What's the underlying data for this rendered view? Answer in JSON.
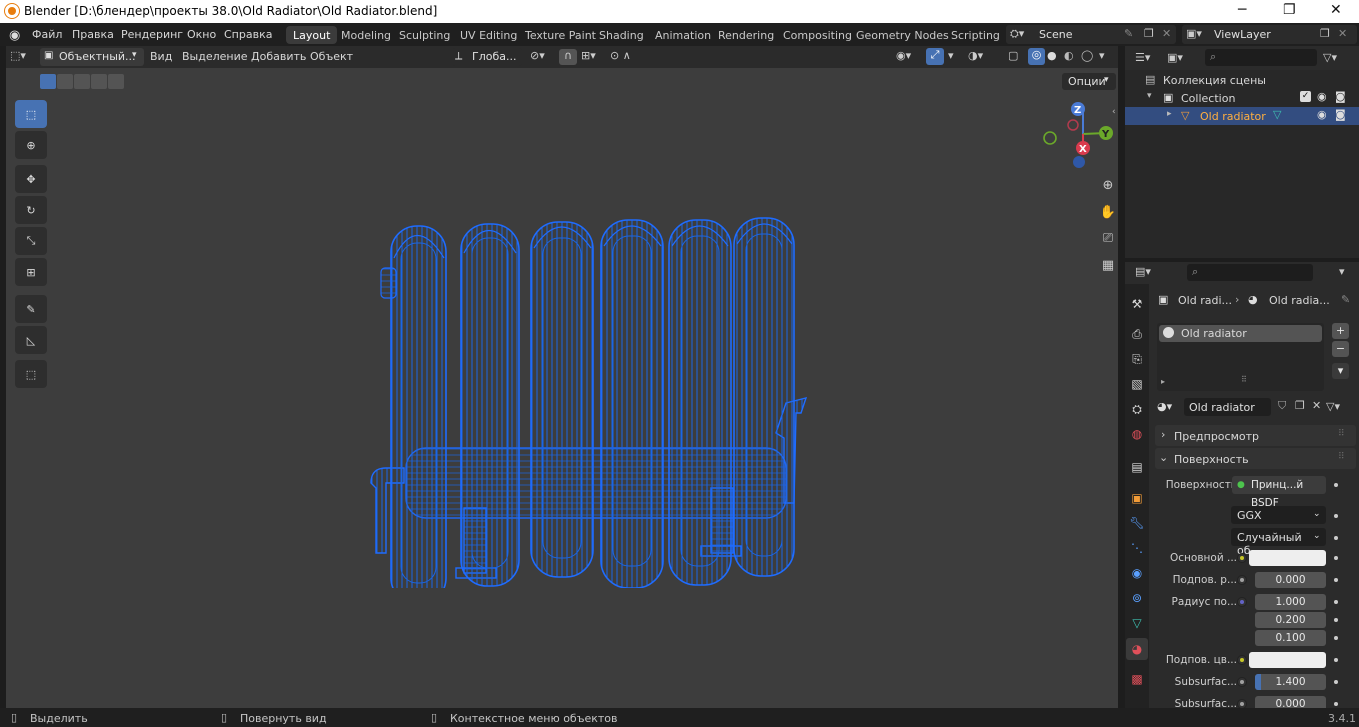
{
  "window": {
    "title": "Blender [D:\\блендер\\проекты 38.0\\Old Radiator\\Old Radiator.blend]",
    "minimize": "─",
    "maximize": "❐",
    "close": "✕"
  },
  "menu": [
    "Файл",
    "Правка",
    "Рендеринг",
    "Окно",
    "Справка"
  ],
  "workspaces": [
    "Layout",
    "Modeling",
    "Sculpting",
    "UV Editing",
    "Texture Paint",
    "Shading",
    "Animation",
    "Rendering",
    "Compositing",
    "Geometry Nodes",
    "Scripting"
  ],
  "active_workspace": "Layout",
  "scene": {
    "name": "Scene"
  },
  "view_layer": {
    "name": "ViewLayer"
  },
  "viewport_header": {
    "mode": "Объектный...",
    "menus": [
      "Вид",
      "Выделение",
      "Добавить",
      "Объект"
    ],
    "orientation": "Глоба...",
    "options": "Опции"
  },
  "gizmo": {
    "z": "Z",
    "y": "Y",
    "x": "X"
  },
  "outliner": {
    "scene_collection": "Коллекция сцены",
    "collection": "Collection",
    "object": "Old radiator"
  },
  "properties": {
    "breadcrumb": [
      "Old radi...",
      "Old radia..."
    ],
    "slot": "Old radiator",
    "material_name": "Old radiator",
    "panels": {
      "preview": "Предпросмотр",
      "surface": "Поверхность"
    },
    "surface_label": "Поверхность",
    "surface_shader": "Принц...й BSDF",
    "distribution": "GGX",
    "subsurface_method": "Случайный об...",
    "rows": [
      {
        "label": "Основной ...",
        "value": "",
        "type": "color",
        "color": "#eeeeee",
        "socket": "#c7c729"
      },
      {
        "label": "Подпов. р...",
        "value": "0.000",
        "type": "num",
        "socket": "#a1a1a1"
      },
      {
        "label": "Радиус по...",
        "value": "1.000",
        "type": "num",
        "socket": "#6363c7"
      },
      {
        "label": "",
        "value": "0.200",
        "type": "num",
        "socket": ""
      },
      {
        "label": "",
        "value": "0.100",
        "type": "num",
        "socket": ""
      },
      {
        "label": "Подпов. цв...",
        "value": "",
        "type": "color",
        "color": "#eeeeee",
        "socket": "#c7c729"
      },
      {
        "label": "Subsurfac...",
        "value": "1.400",
        "type": "num",
        "socket": "#a1a1a1"
      },
      {
        "label": "Subsurfac...",
        "value": "0.000",
        "type": "num",
        "socket": "#a1a1a1"
      }
    ]
  },
  "status": {
    "select": "Выделить",
    "rotate": "Повернуть вид",
    "context": "Контекстное меню объектов",
    "version": "3.4.1"
  },
  "colors": {
    "accent": "#4772b3",
    "wire": "#1a66e6",
    "object_highlight": "#334d80"
  }
}
